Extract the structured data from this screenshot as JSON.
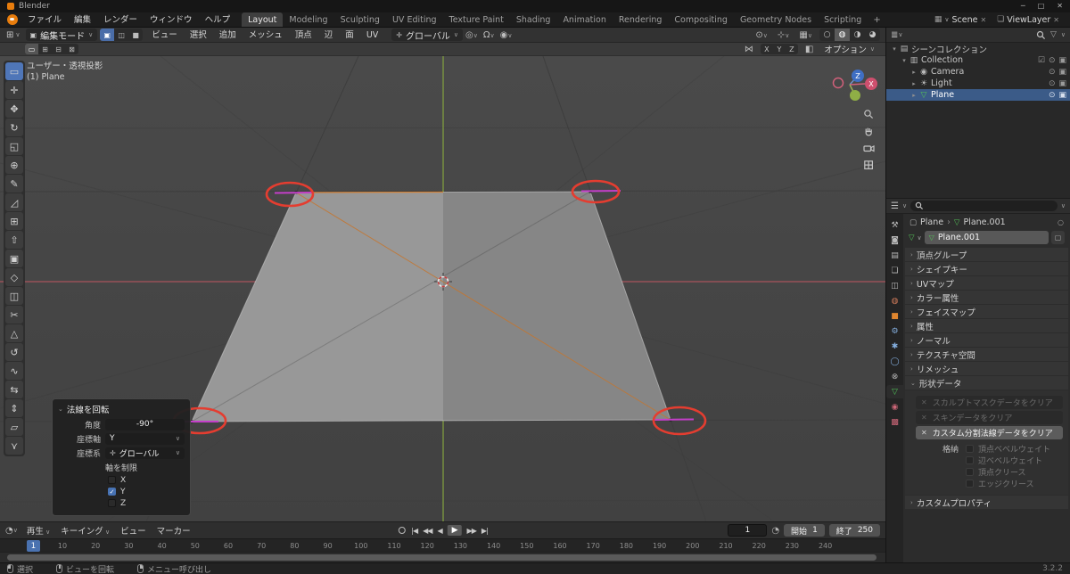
{
  "titlebar": {
    "app_name": "Blender",
    "window_controls": [
      {
        "name": "minimize-button",
        "glyph": "─"
      },
      {
        "name": "maximize-button",
        "glyph": "□"
      },
      {
        "name": "close-button",
        "glyph": "✕"
      }
    ]
  },
  "topbar": {
    "menus": [
      "ファイル",
      "編集",
      "レンダー",
      "ウィンドウ",
      "ヘルプ"
    ],
    "workspaces": [
      {
        "label": "Layout",
        "active": true
      },
      {
        "label": "Modeling"
      },
      {
        "label": "Sculpting"
      },
      {
        "label": "UV Editing"
      },
      {
        "label": "Texture Paint"
      },
      {
        "label": "Shading"
      },
      {
        "label": "Animation"
      },
      {
        "label": "Rendering"
      },
      {
        "label": "Compositing"
      },
      {
        "label": "Geometry Nodes"
      },
      {
        "label": "Scripting"
      }
    ],
    "add_workspace_label": "+",
    "scene_value": "Scene",
    "viewlayer_value": "ViewLayer",
    "close_glyph": "✕"
  },
  "viewport_header": {
    "mode_label": "編集モード",
    "select_modes": [
      {
        "name": "vertex-select-mode",
        "glyph": "▣",
        "active": true
      },
      {
        "name": "edge-select-mode",
        "glyph": "◫",
        "active": false
      },
      {
        "name": "face-select-mode",
        "glyph": "■",
        "active": false
      }
    ],
    "menus": [
      "ビュー",
      "選択",
      "追加",
      "メッシュ",
      "頂点",
      "辺",
      "面",
      "UV"
    ],
    "orientation": "グローバル",
    "shading_modes": [
      {
        "name": "wireframe-shading",
        "glyph": "○",
        "active": false
      },
      {
        "name": "solid-shading",
        "glyph": "◍",
        "active": true
      },
      {
        "name": "material-preview-shading",
        "glyph": "◑",
        "active": false
      },
      {
        "name": "rendered-shading",
        "glyph": "◕",
        "active": false
      }
    ]
  },
  "tool_settings": {
    "mirror_axes": [
      "X",
      "Y",
      "Z"
    ],
    "options_label": "オプション"
  },
  "tools": [
    {
      "name": "tool-select-box",
      "glyph": "▭",
      "active": true
    },
    {
      "name": "tool-cursor",
      "glyph": "✛",
      "active": false
    },
    {
      "name": "tool-move",
      "glyph": "✥",
      "active": false
    },
    {
      "name": "tool-rotate",
      "glyph": "↻",
      "active": false
    },
    {
      "name": "tool-scale",
      "glyph": "◱",
      "active": false
    },
    {
      "name": "tool-transform",
      "glyph": "⊕",
      "active": false
    },
    {
      "name": "tool-annotate",
      "glyph": "✎",
      "active": false
    },
    {
      "name": "tool-measure",
      "glyph": "◿",
      "active": false
    },
    {
      "name": "tool-add-cube",
      "glyph": "⊞",
      "active": false
    },
    {
      "name": "tool-extrude",
      "glyph": "⇧",
      "active": false
    },
    {
      "name": "tool-inset-faces",
      "glyph": "▣",
      "active": false
    },
    {
      "name": "tool-bevel",
      "glyph": "◇",
      "active": false
    },
    {
      "name": "tool-loop-cut",
      "glyph": "◫",
      "active": false
    },
    {
      "name": "tool-knife",
      "glyph": "✂",
      "active": false
    },
    {
      "name": "tool-poly-build",
      "glyph": "△",
      "active": false
    },
    {
      "name": "tool-spin",
      "glyph": "↺",
      "active": false
    },
    {
      "name": "tool-smooth",
      "glyph": "∿",
      "active": false
    },
    {
      "name": "tool-edge-slide",
      "glyph": "⇆",
      "active": false
    },
    {
      "name": "tool-shrink-fatten",
      "glyph": "⇕",
      "active": false
    },
    {
      "name": "tool-shear",
      "glyph": "▱",
      "active": false
    },
    {
      "name": "tool-rip-region",
      "glyph": "⋎",
      "active": false
    }
  ],
  "viewport": {
    "overlay_line1": "ユーザー・透視投影",
    "overlay_line2": "(1) Plane",
    "gizmo_axis_x": "X",
    "gizmo_axis_z": "Z"
  },
  "operator_panel": {
    "title": "法線を回転",
    "fields": [
      {
        "label": "角度",
        "value": "-90°",
        "type": "number"
      },
      {
        "label": "座標軸",
        "value": "Y",
        "type": "dropdown"
      },
      {
        "label": "座標系",
        "value": "グローバル",
        "type": "dropdown",
        "icon_glyph": "✛",
        "icon_name": "orientation-global-icon"
      }
    ],
    "constraint_label": "軸を制限",
    "axes": [
      {
        "label": "X",
        "checked": false
      },
      {
        "label": "Y",
        "checked": true
      },
      {
        "label": "Z",
        "checked": false
      }
    ]
  },
  "timeline": {
    "menus": [
      {
        "label": "再生",
        "dropdown": true
      },
      {
        "label": "キーイング",
        "dropdown": true
      },
      {
        "label": "ビュー",
        "dropdown": false
      },
      {
        "label": "マーカー",
        "dropdown": false
      }
    ],
    "transport": [
      {
        "name": "jump-to-start-button",
        "glyph": "|◀",
        "emphasis": false
      },
      {
        "name": "previous-keyframe-button",
        "glyph": "◀◀",
        "emphasis": false
      },
      {
        "name": "play-reverse-button",
        "glyph": "◀",
        "emphasis": false
      },
      {
        "name": "play-button",
        "glyph": "▶",
        "emphasis": true
      },
      {
        "name": "next-keyframe-button",
        "glyph": "▶▶",
        "emphasis": false
      },
      {
        "name": "jump-to-end-button",
        "glyph": "▶|",
        "emphasis": false
      }
    ],
    "current_frame": "1",
    "start_label": "開始",
    "start_value": "1",
    "end_label": "終了",
    "end_value": "250",
    "ruler_marker": "1",
    "ticks": [
      "10",
      "20",
      "30",
      "40",
      "50",
      "60",
      "70",
      "80",
      "90",
      "100",
      "110",
      "120",
      "130",
      "140",
      "150",
      "160",
      "170",
      "180",
      "190",
      "200",
      "210",
      "220",
      "230",
      "240"
    ]
  },
  "outliner": {
    "rows": [
      {
        "label": "シーンコレクション",
        "depth": 0,
        "icon": "scene-collection-icon",
        "glyph": "▤",
        "disclosure": "▾",
        "checkbox": false,
        "selected": false,
        "toggles": []
      },
      {
        "label": "Collection",
        "depth": 1,
        "icon": "collection-icon",
        "glyph": "▥",
        "disclosure": "▾",
        "checkbox": true,
        "selected": false,
        "toggles": [
          "eye",
          "camera"
        ]
      },
      {
        "label": "Camera",
        "depth": 2,
        "icon": "camera-data-icon",
        "glyph": "◉",
        "disclosure": "▸",
        "checkbox": false,
        "selected": false,
        "toggles": [
          "eye",
          "camera"
        ]
      },
      {
        "label": "Light",
        "depth": 2,
        "icon": "light-data-icon",
        "glyph": "☀",
        "disclosure": "▸",
        "checkbox": false,
        "selected": false,
        "toggles": [
          "eye",
          "camera"
        ]
      },
      {
        "label": "Plane",
        "depth": 2,
        "icon": "mesh-data-icon",
        "glyph": "▽",
        "disclosure": "▸",
        "checkbox": false,
        "selected": true,
        "toggles": [
          "eye",
          "camera"
        ]
      }
    ]
  },
  "properties": {
    "tabs": [
      {
        "name": "tab-tool",
        "glyph": "⚒",
        "color": "#b8b8b8",
        "active": false
      },
      {
        "name": "tab-render",
        "glyph": "◙",
        "color": "#b8b8b8",
        "active": false
      },
      {
        "name": "tab-output",
        "glyph": "▤",
        "color": "#b8b8b8",
        "active": false
      },
      {
        "name": "tab-view-layer",
        "glyph": "❏",
        "color": "#b8b8b8",
        "active": false
      },
      {
        "name": "tab-scene",
        "glyph": "◫",
        "color": "#b8b8b8",
        "active": false
      },
      {
        "name": "tab-world",
        "glyph": "◍",
        "color": "#cf7a5a",
        "active": false
      },
      {
        "name": "tab-object",
        "glyph": "■",
        "color": "#e0862f",
        "active": false
      },
      {
        "name": "tab-modifiers",
        "glyph": "⚙",
        "color": "#84aede",
        "active": false
      },
      {
        "name": "tab-particles",
        "glyph": "✱",
        "color": "#84aede",
        "active": false
      },
      {
        "name": "tab-physics",
        "glyph": "◯",
        "color": "#84aede",
        "active": false
      },
      {
        "name": "tab-constraints",
        "glyph": "⊗",
        "color": "#b8b8b8",
        "active": false
      },
      {
        "name": "tab-object-data",
        "glyph": "▽",
        "color": "#4fc156",
        "active": true
      },
      {
        "name": "tab-material",
        "glyph": "◉",
        "color": "#cc6677",
        "active": false
      },
      {
        "name": "tab-texture",
        "glyph": "▩",
        "color": "#cc6677",
        "active": false
      }
    ],
    "breadcrumb": {
      "object": "Plane",
      "separator": "›",
      "data": "Plane.001"
    },
    "name_value": "Plane.001",
    "panels_collapsed": [
      "頂点グループ",
      "シェイプキー",
      "UVマップ",
      "カラー属性",
      "フェイスマップ",
      "属性",
      "ノーマル",
      "テクスチャ空間",
      "リメッシュ"
    ],
    "geometry_panel": {
      "title": "形状データ",
      "buttons": [
        {
          "label": "スカルプトマスクデータをクリア",
          "enabled": false
        },
        {
          "label": "スキンデータをクリア",
          "enabled": false
        },
        {
          "label": "カスタム分割法線データをクリア",
          "enabled": true
        }
      ],
      "store_label": "格納",
      "store_items": [
        "頂点ベベルウェイト",
        "辺ベベルウェイト",
        "頂点クリース",
        "エッジクリース"
      ]
    },
    "custom_properties_label": "カスタムプロパティ"
  },
  "statusbar": {
    "items": [
      {
        "icon": "mouse-left",
        "label": "選択"
      },
      {
        "icon": "mouse-middle",
        "label": "ビューを回転"
      },
      {
        "icon": "mouse-right",
        "label": "メニュー呼び出し"
      }
    ],
    "version": "3.2.2"
  }
}
